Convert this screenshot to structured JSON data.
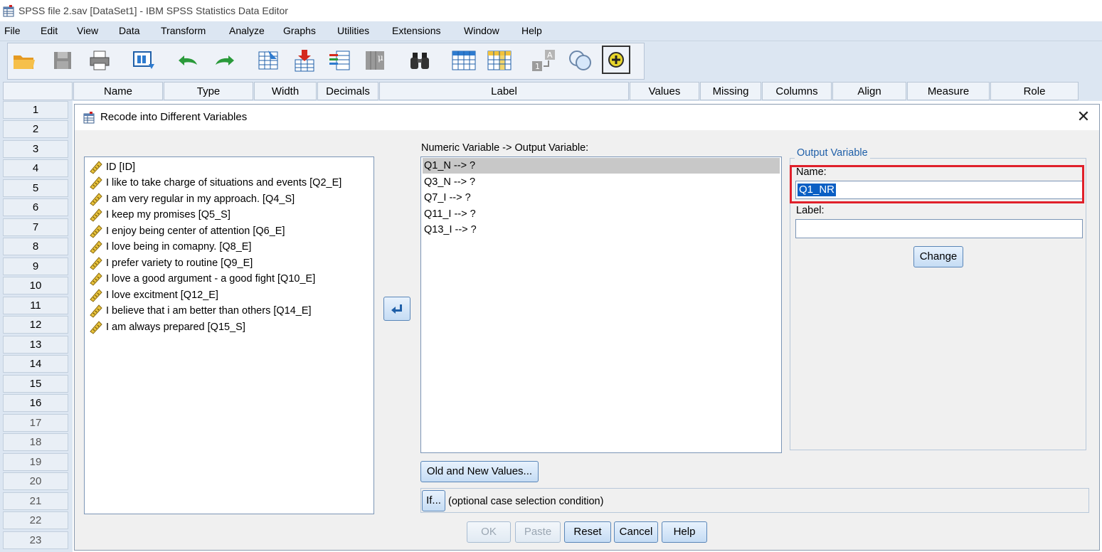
{
  "window": {
    "title": "SPSS file 2.sav [DataSet1] - IBM SPSS Statistics Data Editor"
  },
  "menu": [
    "File",
    "Edit",
    "View",
    "Data",
    "Transform",
    "Analyze",
    "Graphs",
    "Utilities",
    "Extensions",
    "Window",
    "Help"
  ],
  "toolbar": {
    "icons": [
      "open-folder-icon",
      "save-icon",
      "print-icon",
      "dialog-recall-icon",
      "undo-icon",
      "redo-icon",
      "goto-case-icon",
      "goto-variable-icon",
      "variables-icon",
      "run-descriptives-icon",
      "find-icon",
      "insert-cases-icon",
      "insert-variable-icon",
      "split-file-icon",
      "value-labels-icon",
      "use-sets-icon",
      "customize-icon"
    ]
  },
  "grid": {
    "columns": [
      "Name",
      "Type",
      "Width",
      "Decimals",
      "Label",
      "Values",
      "Missing",
      "Columns",
      "Align",
      "Measure",
      "Role"
    ],
    "rows": [
      "1",
      "2",
      "3",
      "4",
      "5",
      "6",
      "7",
      "8",
      "9",
      "10",
      "11",
      "12",
      "13",
      "14",
      "15",
      "16",
      "17",
      "18",
      "19",
      "20",
      "21",
      "22",
      "23"
    ]
  },
  "dialog": {
    "title": "Recode into Different Variables",
    "close_glyph": "✕",
    "source_variables": [
      "ID [ID]",
      "I like to take charge of situations and events [Q2_E]",
      "I am very regular in my approach. [Q4_S]",
      "I keep my promises [Q5_S]",
      "I enjoy being center of attention [Q6_E]",
      "I love being in comapny. [Q8_E]",
      "I prefer variety to routine [Q9_E]",
      "I love a good argument - a good fight [Q10_E]",
      "I love excitment [Q12_E]",
      "I believe that i am better than others  [Q14_E]",
      "I am always prepared [Q15_S]"
    ],
    "mapping_label": "Numeric Variable -> Output Variable:",
    "mappings": [
      "Q1_N --> ?",
      "Q3_N --> ?",
      "Q7_I --> ?",
      "Q11_I --> ?",
      "Q13_I --> ?"
    ],
    "output_group_label": "Output Variable",
    "name_label": "Name:",
    "name_value": "Q1_NR",
    "label_label": "Label:",
    "label_value": "",
    "change_button": "Change",
    "old_new_button": "Old and New Values...",
    "if_button": "If...",
    "if_text": "(optional case selection condition)",
    "buttons": {
      "ok": "OK",
      "paste": "Paste",
      "reset": "Reset",
      "cancel": "Cancel",
      "help": "Help"
    }
  },
  "colors": {
    "highlight": "#e0202a",
    "selection": "#0b5fc4",
    "chrome": "#dce6f2"
  }
}
